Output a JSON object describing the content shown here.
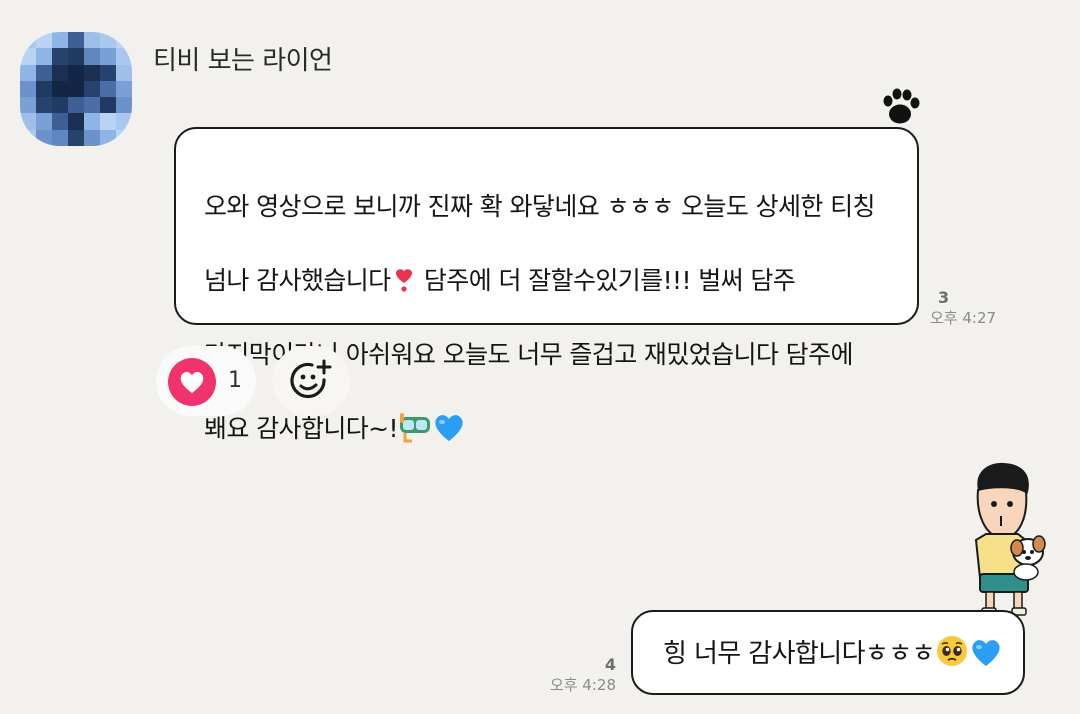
{
  "chat": {
    "sender_name": "티비 보는 라이언",
    "message_1": {
      "line_1": "오와 영상으로 보니까 진짜 확 와닿네요 ㅎㅎㅎ 오늘도 상세한 티칭",
      "line_2a": "넘나 감사했습니다",
      "line_2b": " 담주에 더 잘할수있기를!!! 벌써 담주",
      "line_3": "마지막이라니 아쉬워요 오늘도 너무 즐겁고 재밌었습니다 담주에",
      "line_4": "봬요 감사합니다~!",
      "unread_count": "3",
      "time": "오후 4:27"
    },
    "reaction": {
      "icon": "heart-icon",
      "count": "1",
      "add_icon": "add-emoji-icon"
    },
    "message_2": {
      "text": "힝 너무 감사합니다ㅎㅎㅎ",
      "unread_count": "4",
      "time": "오후 4:28"
    }
  },
  "colors": {
    "background": "#f2f1ed",
    "bubble": "#ffffff",
    "bubble_border": "#1a1a1a",
    "heart": "#f0336d",
    "heart_blue": "#2a9df4"
  }
}
